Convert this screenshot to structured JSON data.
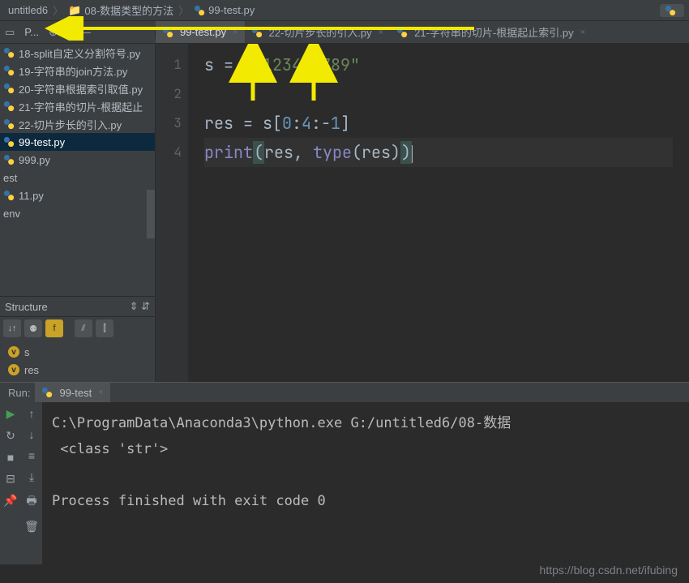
{
  "breadcrumb": {
    "project": "untitled6",
    "folder": "08-数据类型的方法",
    "file": "99-test.py"
  },
  "toolbar": {
    "selector": "P..."
  },
  "tabs": [
    {
      "label": "99-test.py",
      "active": true
    },
    {
      "label": "22-切片步长的引入.py",
      "active": false
    },
    {
      "label": "21-字符串的切片-根据起止索引.py",
      "active": false
    }
  ],
  "files": [
    "18-split自定义分割符号.py",
    "19-字符串的join方法.py",
    "20-字符串根据索引取值.py",
    "21-字符串的切片-根据起止",
    "22-切片步长的引入.py",
    "99-test.py",
    "999.py"
  ],
  "plain_items": [
    "est",
    "11.py",
    "env"
  ],
  "structure": {
    "title": "Structure",
    "vars": [
      "s",
      "res"
    ]
  },
  "code": {
    "lines": [
      {
        "n": "1"
      },
      {
        "n": "2"
      },
      {
        "n": "3"
      },
      {
        "n": "4"
      }
    ],
    "l1_a": "s = ",
    "l1_str": "\"0123456789\"",
    "l3_a": "res = s[",
    "l3_n1": "0",
    "l3_c1": ":",
    "l3_n2": "4",
    "l3_c2": ":-",
    "l3_n3": "1",
    "l3_b": "]",
    "l4_fn": "print",
    "l4_a": "(",
    "l4_args": "res, ",
    "l4_type": "type",
    "l4_b": "(res)",
    "l4_c": ")"
  },
  "run": {
    "title": "Run:",
    "tab": "99-test",
    "out1": "C:\\ProgramData\\Anaconda3\\python.exe G:/untitled6/08-数据",
    "out2": " <class 'str'>",
    "out3": "Process finished with exit code 0"
  },
  "watermark": "https://blog.csdn.net/ifubing"
}
